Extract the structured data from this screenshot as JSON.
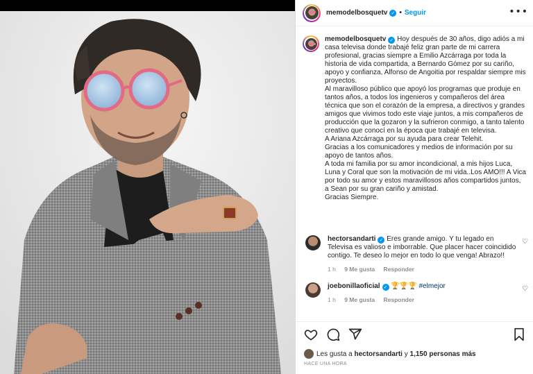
{
  "post": {
    "username": "memodelbosquetv",
    "follow_label": "Seguir",
    "more_label": "•••"
  },
  "caption": {
    "username": "memodelbosquetv",
    "paragraphs": [
      "Hoy después de 30 años, digo adiós a mi casa televisa donde trabajé feliz gran parte de mi carrera profesional, gracias siempre a Emilio Azcárraga por toda la historia de vida compartida, a Bernardo Gómez por su cariño, apoyo y confianza, Alfonso de Angoitia por respaldar siempre mis proyectos.",
      "Al maravilloso público que apoyó los programas que produje en tantos años, a todos los ingenieros y compañeros del área técnica que son el corazón de la empresa, a directivos y grandes amigos que vivimos todo este viaje juntos, a mis compañeros de producción que la gozaron y la sufrieron conmigo, a tanto talento creativo que conocí en la época que trabajé en televisa.",
      "A Ariana Azcárraga por su ayuda para crear Telehit.",
      "Gracias a los comunicadores y medios de información por su apoyo de tantos años.",
      "A toda mi familia por su amor incondicional, a mis hijos Luca, Luna y Coral que son la motivación de mi vida..Los AMO!!! A Vica por todo su amor y estos maravillosos años compartidos juntos, a Sean por su gran cariño y amistad.",
      "Gracias Siempre."
    ]
  },
  "comments": [
    {
      "username": "hectorsandarti",
      "text": "Eres grande amigo. Y tu legado en Televisa es valioso e imborrable. Que placer hacer coincidido contigo. Te deseo lo mejor en todo lo que venga! Abrazo!!",
      "time": "1 h",
      "likes": "9 Me gusta",
      "reply": "Responder"
    },
    {
      "username": "joebonillaoficial",
      "trophies": "🏆🏆🏆",
      "hashtag": "#elmejor",
      "time": "1 h",
      "likes": "9 Me gusta",
      "reply": "Responder"
    }
  ],
  "likes_bar": {
    "prefix": "Les gusta a",
    "first_user": "hectorsandarti",
    "joiner": "y",
    "others": "1,150 personas más"
  },
  "timestamp": "HACE UNA HORA",
  "icons": {
    "heart": "heart-icon",
    "comment": "comment-icon",
    "share": "share-icon",
    "save": "bookmark-icon",
    "verified": "verified-badge-icon",
    "more": "more-options-icon"
  },
  "colors": {
    "accent": "#0095f6",
    "text": "#262626",
    "muted": "#8e8e8e",
    "hashtag": "#00376b"
  }
}
